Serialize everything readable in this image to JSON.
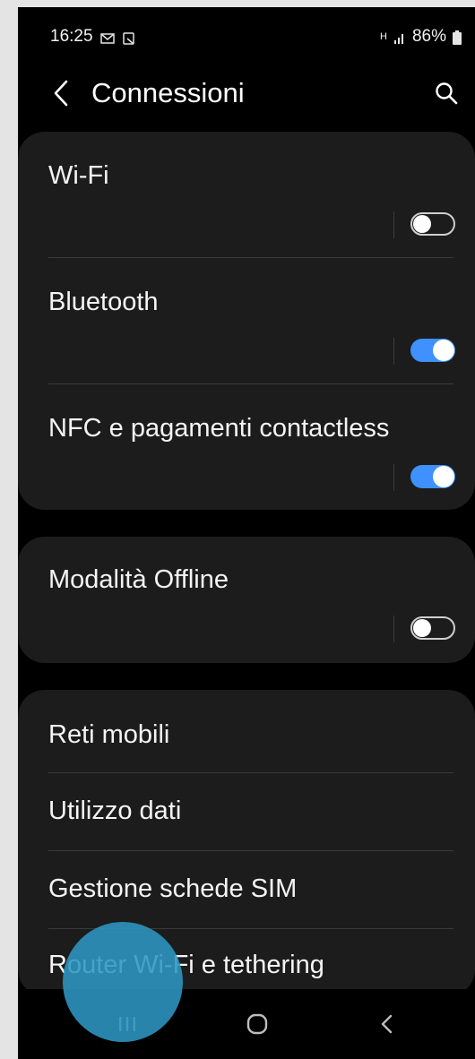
{
  "status_bar": {
    "time": "16:25",
    "notif_icons": [
      "mail-icon",
      "screenshot-icon"
    ],
    "network": "H",
    "signal_icon": "signal-bars-icon",
    "battery": "86%",
    "battery_icon": "battery-icon"
  },
  "header": {
    "title": "Connessioni",
    "back_icon": "chevron-left-icon",
    "search_icon": "search-icon"
  },
  "toggle_group_1": {
    "items": [
      {
        "label": "Wi-Fi",
        "state": "off"
      },
      {
        "label": "Bluetooth",
        "state": "on"
      },
      {
        "label": "NFC e pagamenti contactless",
        "state": "on"
      }
    ]
  },
  "toggle_group_2": {
    "items": [
      {
        "label": "Modalità Offline",
        "state": "off"
      }
    ]
  },
  "menu_group": {
    "items": [
      {
        "label": "Reti mobili"
      },
      {
        "label": "Utilizzo dati"
      },
      {
        "label": "Gestione schede SIM"
      },
      {
        "label": "Router Wi-Fi e tethering"
      }
    ]
  },
  "nav_bar": {
    "recents_icon": "recents-icon",
    "home_icon": "home-icon",
    "back_icon": "back-icon"
  },
  "colors": {
    "background": "#000000",
    "card": "#1c1c1c",
    "accent": "#3e91ff",
    "touch_indicator": "#2e96c3"
  }
}
